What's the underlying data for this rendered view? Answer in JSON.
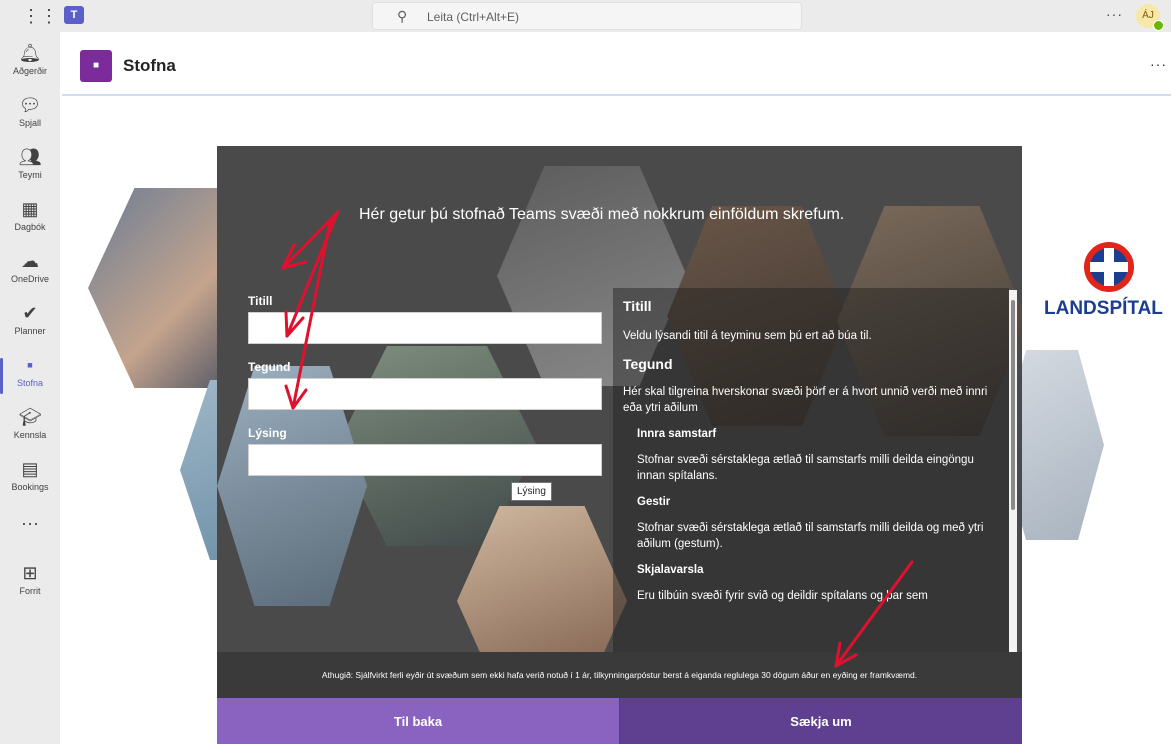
{
  "topbar": {
    "waffle_icon": "⋮⋮⋮",
    "teams_icon": "T",
    "search_placeholder": "Leita (Ctrl+Alt+E)",
    "more": "···",
    "avatar_initials": "ÁJ"
  },
  "rail": {
    "items": [
      {
        "icon": "bell-icon",
        "glyph": "🔔︎",
        "label": "Aðgerðir"
      },
      {
        "icon": "chat-icon",
        "glyph": "💬︎",
        "label": "Spjall"
      },
      {
        "icon": "teams-icon",
        "glyph": "👥︎",
        "label": "Teymi"
      },
      {
        "icon": "calendar-icon",
        "glyph": "▦",
        "label": "Dagbók"
      },
      {
        "icon": "cloud-icon",
        "glyph": "☁",
        "label": "OneDrive"
      },
      {
        "icon": "planner-icon",
        "glyph": "✔",
        "label": "Planner"
      },
      {
        "icon": "stofna-app-icon",
        "glyph": "▪",
        "label": "Stofna"
      },
      {
        "icon": "graduation-cap-icon",
        "glyph": "🎓︎",
        "label": "Kennsla"
      },
      {
        "icon": "bookings-icon",
        "glyph": "▤",
        "label": "Bookings"
      },
      {
        "icon": "more-apps-icon",
        "glyph": "···",
        "label": ""
      },
      {
        "icon": "add-app-icon",
        "glyph": "⊞",
        "label": "Forrit"
      }
    ]
  },
  "app": {
    "title": "Stofna",
    "more": "···"
  },
  "logo": {
    "text": "LANDSPÍTAL"
  },
  "wizard": {
    "heading": "Hér getur þú stofnað Teams svæði með nokkrum einföldum skrefum.",
    "fields": {
      "title_label": "Titill",
      "title_value": "",
      "type_label": "Tegund",
      "type_value": "",
      "desc_label": "Lýsing",
      "desc_value": ""
    },
    "tooltip": "Lýsing",
    "help": {
      "h_title": "Titill",
      "p_title": "Veldu lýsandi titil á teyminu sem þú ert að búa til.",
      "h_type": "Tegund",
      "p_type": "Hér skal tilgreina hverskonar svæði þörf er á hvort unnið verði með innri eða ytri aðilum",
      "h_internal": "Innra samstarf",
      "p_internal": "Stofnar svæði sérstaklega ætlað til samstarfs milli deilda eingöngu innan spítalans.",
      "h_guests": "Gestir",
      "p_guests": "Stofnar svæði sérstaklega ætlað til samstarfs milli deilda og með ytri aðilum (gestum).",
      "h_docs": "Skjalavarsla",
      "p_docs": "Eru tilbúin svæði fyrir svið og deildir spítalans og þar sem"
    },
    "notice": "Athugið: Sjálfvirkt ferli eyðir út svæðum sem ekki hafa verið notuð í 1 ár, tilkynningarpóstur berst á eiganda reglulega 30 dögum áður en eyðing er framkvæmd.",
    "back_label": "Til baka",
    "apply_label": "Sækja um"
  },
  "colors": {
    "rail_bg": "#ebebeb",
    "accent": "#5b5fc7",
    "back_button": "#8a63c1",
    "apply_button": "#5f3f8f",
    "annotation_arrows": "#e0102f"
  }
}
